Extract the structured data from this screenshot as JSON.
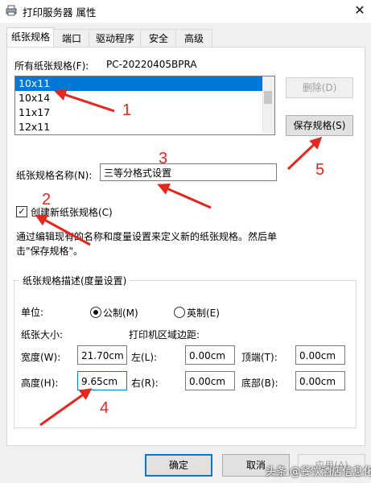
{
  "window": {
    "title": "打印服务器 属性",
    "close_glyph": "✕"
  },
  "tabs": [
    {
      "label": "纸张规格"
    },
    {
      "label": "端口"
    },
    {
      "label": "驱动程序"
    },
    {
      "label": "安全"
    },
    {
      "label": "高级"
    }
  ],
  "forms_section": {
    "label": "所有纸张规格(F):",
    "server_name": "PC-20220405BPRA",
    "items": [
      "10x11",
      "10x14",
      "11x17",
      "12x11"
    ],
    "selected_index": 0
  },
  "buttons": {
    "delete": "删除(D)",
    "save": "保存规格(S)",
    "ok": "确定",
    "cancel": "取消",
    "apply": "应用(A)"
  },
  "form_name": {
    "label": "纸张规格名称(N):",
    "value": "三等分格式设置"
  },
  "create_new": {
    "label": "创建新纸张规格(C)",
    "checked": true,
    "check_glyph": "✓"
  },
  "description": "通过编辑现有的名称和度量设置来定义新的纸张规格。然后单击\"保存规格\"。",
  "measurements": {
    "group_title": "纸张规格描述(度量设置)",
    "units_label": "单位:",
    "unit_metric": "公制(M)",
    "unit_english": "英制(E)",
    "selected_unit": "metric",
    "paper_size_label": "纸张大小:",
    "margins_label": "打印机区域边距:",
    "width_label": "宽度(W):",
    "width_value": "21.70cm",
    "height_label": "高度(H):",
    "height_value": "9.65cm",
    "left_label": "左(L):",
    "left_value": "0.00cm",
    "right_label": "右(R):",
    "right_value": "0.00cm",
    "top_label": "顶端(T):",
    "top_value": "0.00cm",
    "bottom_label": "底部(B):",
    "bottom_value": "0.00cm"
  },
  "annotations": {
    "arrow_color": "#e5261f",
    "numbers": [
      "1",
      "2",
      "3",
      "4",
      "5"
    ]
  },
  "watermark": "头条 @餐饮酒店信息化"
}
